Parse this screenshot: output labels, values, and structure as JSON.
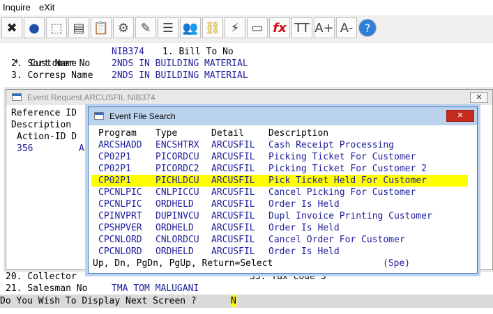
{
  "menubar": {
    "inquire": "Inquire",
    "exit": "eXit"
  },
  "toolbar": {
    "buttons": [
      {
        "name": "exit-icon",
        "glyph": "✖"
      },
      {
        "name": "globe-icon",
        "glyph": "●"
      },
      {
        "name": "select-icon",
        "glyph": "⬚"
      },
      {
        "name": "document-icon",
        "glyph": "▤"
      },
      {
        "name": "clipboard-icon",
        "glyph": "📋"
      },
      {
        "name": "settings-icon",
        "glyph": "⚙"
      },
      {
        "name": "edit-icon",
        "glyph": "✎"
      },
      {
        "name": "list-icon",
        "glyph": "☰"
      },
      {
        "name": "users-icon",
        "glyph": "👥"
      },
      {
        "name": "link-icon",
        "glyph": "⛓"
      },
      {
        "name": "lightning-icon",
        "glyph": "⚡"
      },
      {
        "name": "window-edit-icon",
        "glyph": "▭"
      },
      {
        "name": "function-icon",
        "glyph": "fx"
      },
      {
        "name": "text-size-icon",
        "glyph": "TT"
      },
      {
        "name": "font-increase-icon",
        "glyph": "A+"
      },
      {
        "name": "font-decrease-icon",
        "glyph": "A-"
      },
      {
        "name": "help-icon",
        "glyph": "?"
      }
    ]
  },
  "screen": {
    "line1_label": "*  Customer No",
    "line1_value": "NIB374",
    "line1_extra": "1. Bill To No",
    "line2_label": "2. Sort Name",
    "line2_value": "2NDS IN BUILDING MATERIAL",
    "line3_label": "3. Corresp Name",
    "line3_value": "2NDS IN BUILDING MATERIAL",
    "line20": "20. Collector",
    "line33": "33. Tax Code 3",
    "line21_label": "21. Salesman No",
    "line21_value": "TMA TOM MALUGANI",
    "prompt": "Do You Wish To Display Next Screen ?",
    "answer": "N"
  },
  "event_request": {
    "title": "Event Request ARCUSFIL NIB374",
    "close": "✕",
    "ref_label": "Reference ID",
    "desc_label": "Description",
    "action_header": "Action-ID D",
    "action_id": "356",
    "action_code": "A"
  },
  "event_search": {
    "title": "Event File Search",
    "close": "✕",
    "columns": [
      "Program",
      "Type",
      "Detail",
      "Description"
    ],
    "rows": [
      {
        "program": "ARCSHADD",
        "type": "ENCSHTRX",
        "detail": "ARCUSFIL",
        "description": "Cash Receipt Processing"
      },
      {
        "program": "CP02P1",
        "type": "PICORDCU",
        "detail": "ARCUSFIL",
        "description": "Picking Ticket For Customer"
      },
      {
        "program": "CP02P1",
        "type": "PICORDC2",
        "detail": "ARCUSFIL",
        "description": "Picking Ticket For Customer 2"
      },
      {
        "program": "CP02P1",
        "type": "PICHLDCU",
        "detail": "ARCUSFIL",
        "description": "Pick Ticket Held For Customer"
      },
      {
        "program": "CPCNLPIC",
        "type": "CNLPICCU",
        "detail": "ARCUSFIL",
        "description": "Cancel Picking For Customer"
      },
      {
        "program": "CPCNLPIC",
        "type": "ORDHELD",
        "detail": "ARCUSFIL",
        "description": "Order Is Held"
      },
      {
        "program": "CPINVPRT",
        "type": "DUPINVCU",
        "detail": "ARCUSFIL",
        "description": "Dupl Invoice Printing Customer"
      },
      {
        "program": "CPSHPVER",
        "type": "ORDHELD",
        "detail": "ARCUSFIL",
        "description": "Order Is Held"
      },
      {
        "program": "CPCNLORD",
        "type": "CNLORDCU",
        "detail": "ARCUSFIL",
        "description": "Cancel Order For Customer"
      },
      {
        "program": "CPCNLORD",
        "type": "ORDHELD",
        "detail": "ARCUSFIL",
        "description": "Order Is Held"
      }
    ],
    "selected_index": 3,
    "footer": "Up, Dn, PgDn, PgUp, Return=Select",
    "footer_mode": "(Spe)"
  }
}
